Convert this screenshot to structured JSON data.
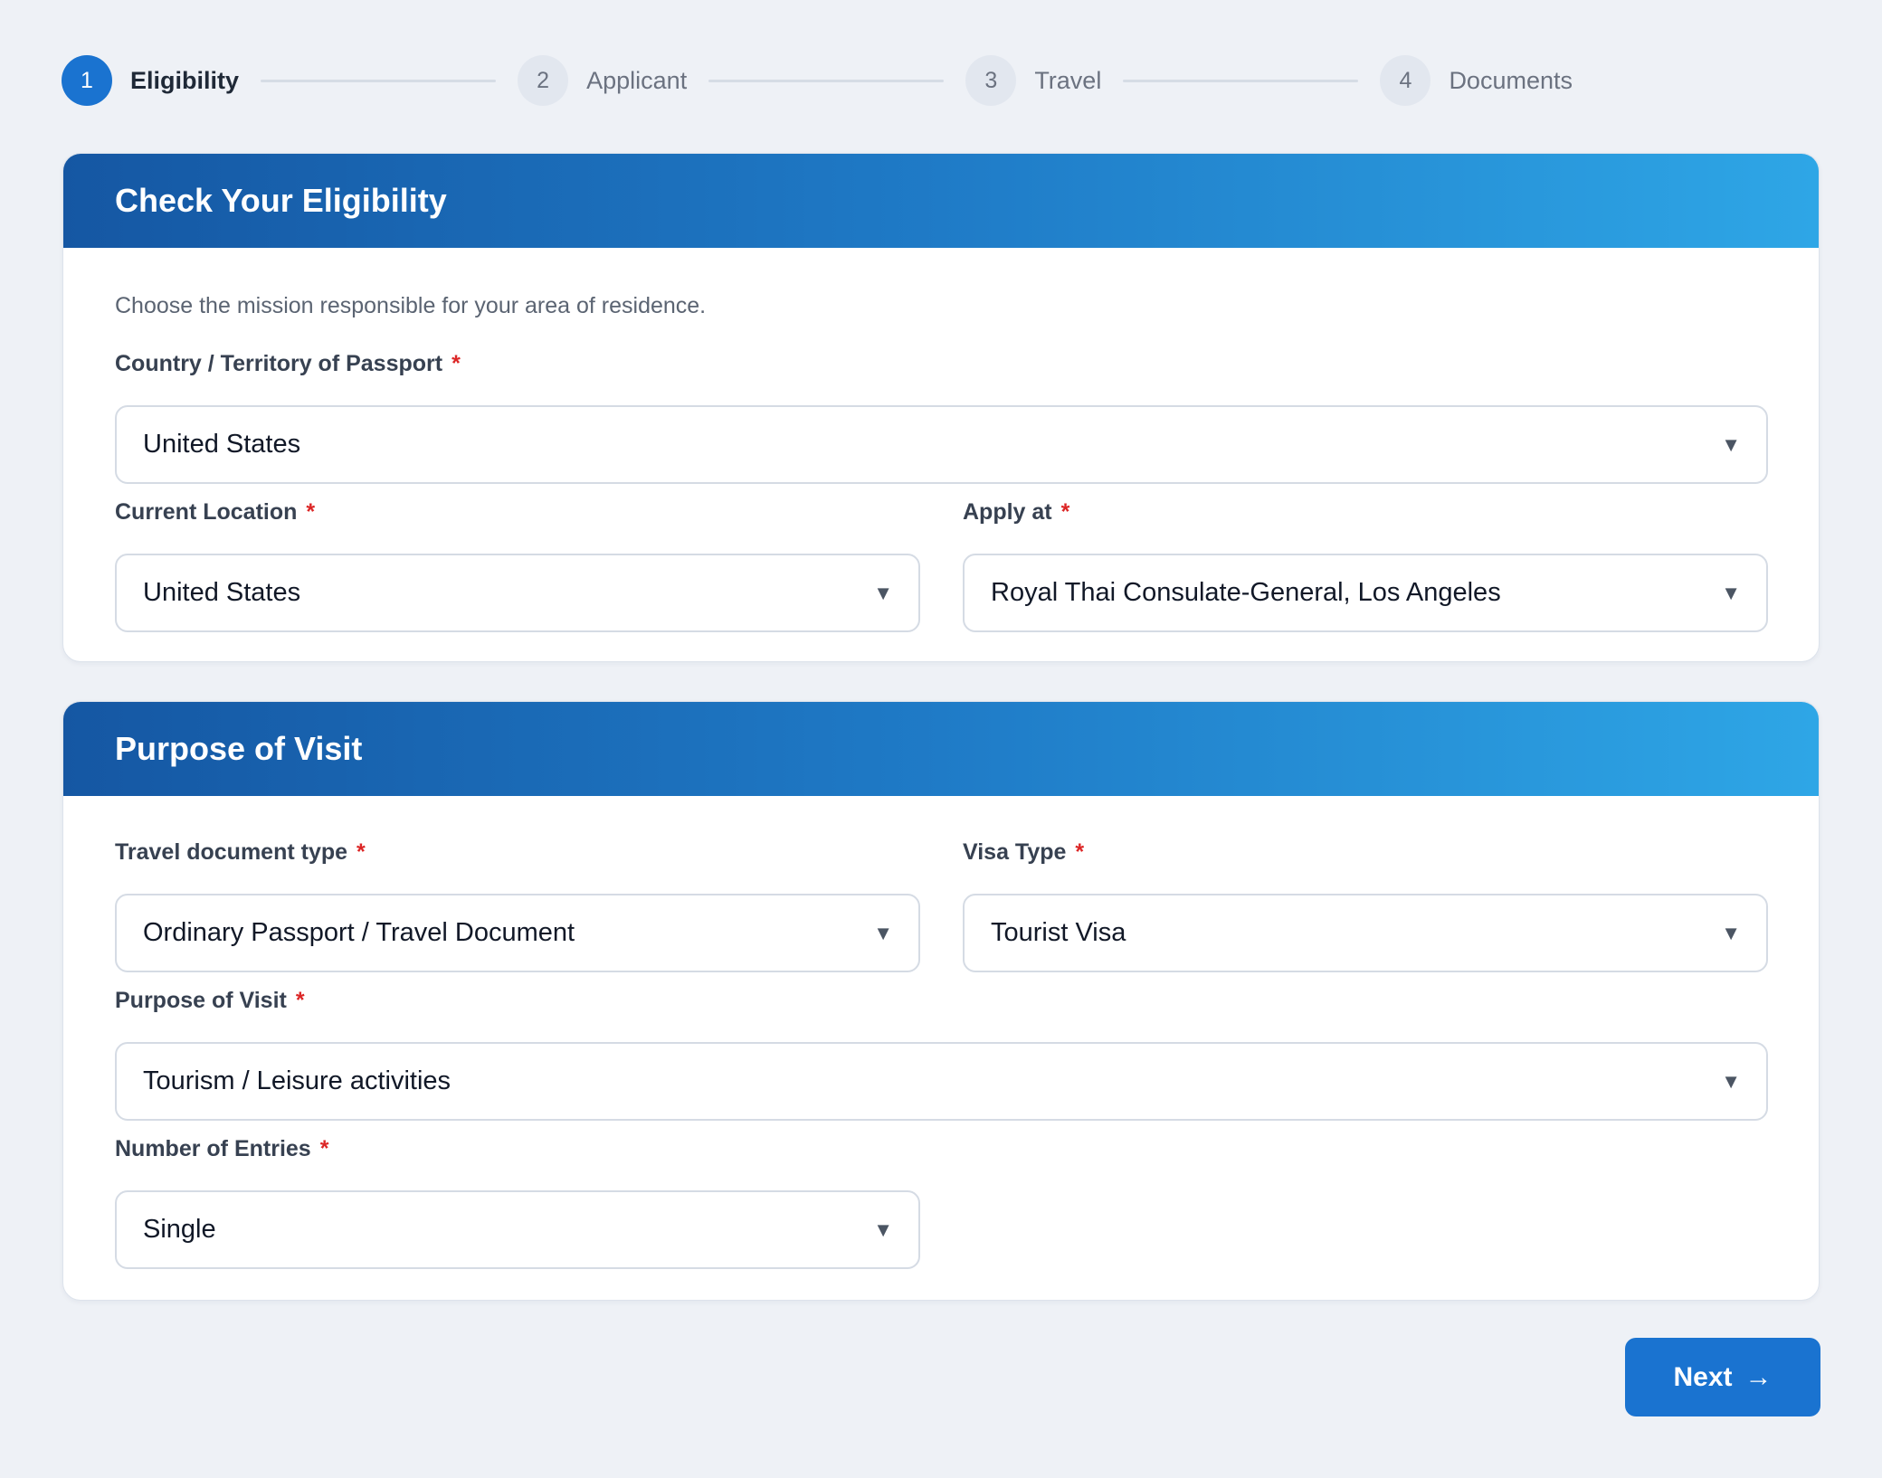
{
  "stepper": {
    "steps": [
      {
        "number": "1",
        "label": "Eligibility",
        "active": true
      },
      {
        "number": "2",
        "label": "Applicant",
        "active": false
      },
      {
        "number": "3",
        "label": "Travel",
        "active": false
      },
      {
        "number": "4",
        "label": "Documents",
        "active": false
      }
    ]
  },
  "eligibility": {
    "title": "Check Your Eligibility",
    "hint": "Choose the mission responsible for your area of residence.",
    "passport_country": {
      "label": "Country / Territory of Passport",
      "required": "*",
      "value": "United States"
    },
    "current_location": {
      "label": "Current Location",
      "required": "*",
      "value": "United States"
    },
    "apply_at": {
      "label": "Apply at",
      "required": "*",
      "value": "Royal Thai Consulate-General, Los Angeles"
    }
  },
  "purpose": {
    "title": "Purpose of Visit",
    "document_type": {
      "label": "Travel document type",
      "required": "*",
      "value": "Ordinary Passport / Travel Document"
    },
    "visa_type": {
      "label": "Visa Type",
      "required": "*",
      "value": "Tourist Visa"
    },
    "purpose_of_visit": {
      "label": "Purpose of Visit",
      "required": "*",
      "value": "Tourism / Leisure activities"
    },
    "entries": {
      "label": "Number of Entries",
      "required": "*",
      "value": "Single"
    }
  },
  "actions": {
    "next_label": "Next",
    "next_arrow": "→"
  },
  "icons": {
    "dropdown": "▼"
  },
  "colors": {
    "primary": "#1a73d0",
    "header_start": "#1557a3",
    "header_end": "#2ea6e6",
    "required": "#dc2626"
  }
}
